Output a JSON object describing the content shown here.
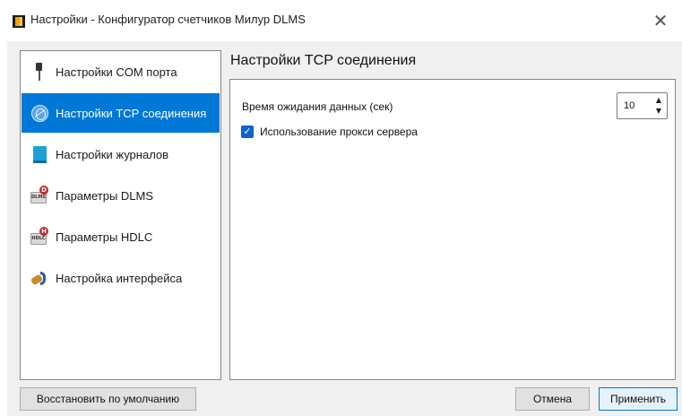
{
  "window": {
    "title": "Настройки - Конфигуратор счетчиков Милур DLMS",
    "close_glyph": "✕"
  },
  "sidebar": {
    "items": [
      {
        "label": "Настройки COM порта",
        "icon": "usb-plug-icon",
        "selected": false
      },
      {
        "label": "Настройки TCP соединения",
        "icon": "globe-network-icon",
        "selected": true
      },
      {
        "label": "Настройки журналов",
        "icon": "journal-book-icon",
        "selected": false
      },
      {
        "label": "Параметры DLMS",
        "icon": "dlms-badge-icon",
        "badge_text": "DLMS",
        "badge_letter": "D",
        "selected": false
      },
      {
        "label": "Параметры HDLC",
        "icon": "hdlc-badge-icon",
        "badge_text": "HDLC",
        "badge_letter": "H",
        "selected": false
      },
      {
        "label": "Настройка интерфейса",
        "icon": "paint-brush-icon",
        "selected": false
      }
    ]
  },
  "panel": {
    "title": "Настройки TCP соединения",
    "timeout": {
      "label": "Время ожидания данных (сек)",
      "value": "10",
      "up_glyph": "▲",
      "down_glyph": "▼"
    },
    "proxy": {
      "label": "Использование прокси сервера",
      "checked": true,
      "check_glyph": "✓"
    }
  },
  "buttons": {
    "restore": "Восстановить по умолчанию",
    "cancel": "Отмена",
    "apply": "Применить"
  },
  "colors": {
    "selection": "#0078d7",
    "checkbox": "#0b64c9",
    "primary_button_border": "#0078d7"
  }
}
